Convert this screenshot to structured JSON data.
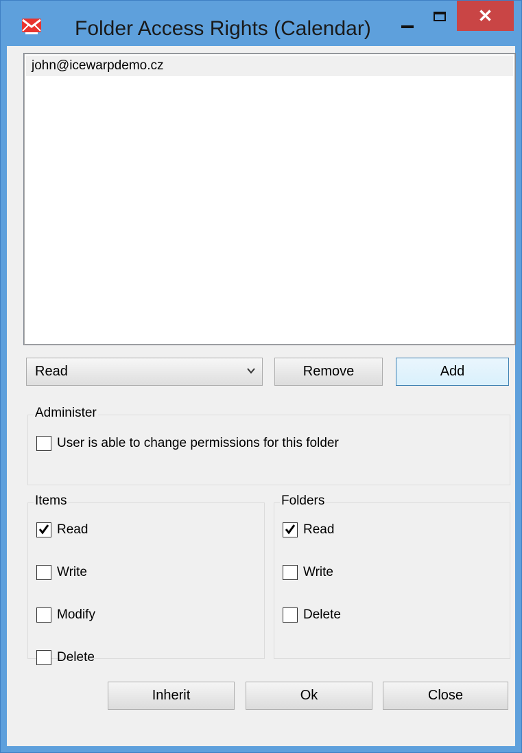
{
  "window": {
    "title": "Folder Access Rights (Calendar)",
    "close_glyph": "✕"
  },
  "userlist": {
    "items": [
      "john@icewarpdemo.cz"
    ]
  },
  "rights": {
    "selected": "Read",
    "remove_label": "Remove",
    "add_label": "Add"
  },
  "administer": {
    "label": "Administer",
    "option": {
      "label": "User is able to change permissions for this folder",
      "checked": false
    }
  },
  "items_group": {
    "label": "Items",
    "options": [
      {
        "label": "Read",
        "checked": true
      },
      {
        "label": "Write",
        "checked": false
      },
      {
        "label": "Modify",
        "checked": false
      },
      {
        "label": "Delete",
        "checked": false
      }
    ]
  },
  "folders_group": {
    "label": "Folders",
    "options": [
      {
        "label": "Read",
        "checked": true
      },
      {
        "label": "Write",
        "checked": false
      },
      {
        "label": "Delete",
        "checked": false
      }
    ]
  },
  "footer": {
    "inherit_label": "Inherit",
    "ok_label": "Ok",
    "close_label": "Close"
  },
  "colors": {
    "title_bar": "#5ea0dc",
    "close_button": "#c94545",
    "dialog_bg": "#f0f0f0"
  }
}
